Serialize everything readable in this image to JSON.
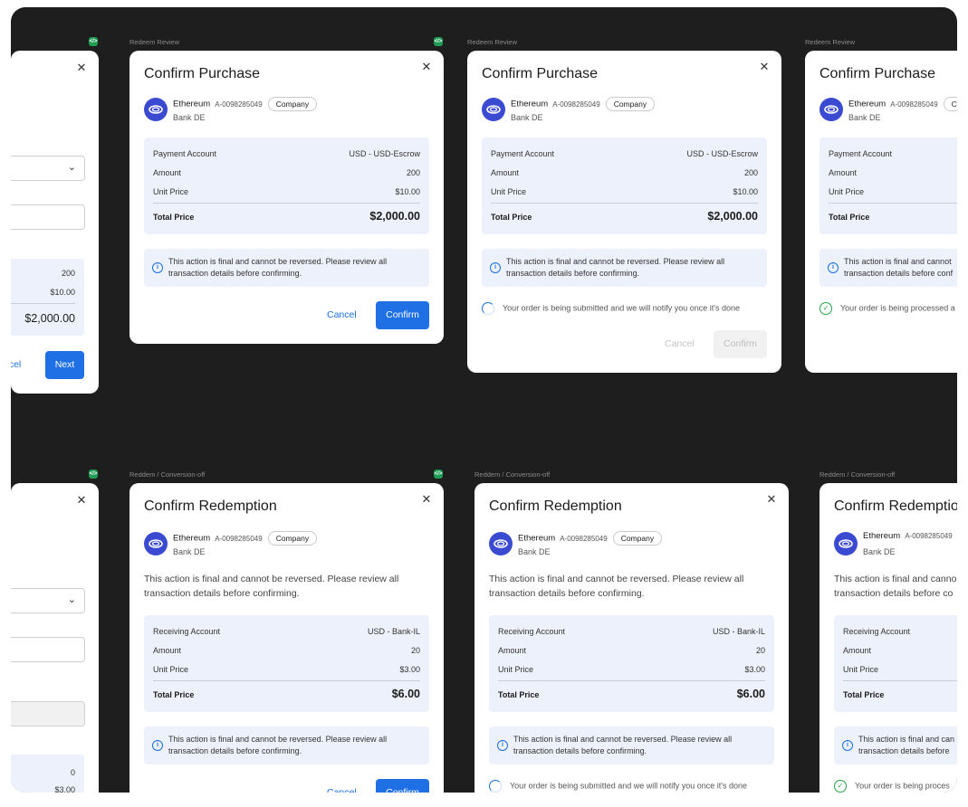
{
  "labels": {
    "top": "Redeem Review",
    "bottom": "Reddem / Conversion-off",
    "dev_badge": "</>"
  },
  "asset": {
    "name": "Ethereum",
    "id": "A-0098285049",
    "type_tag": "Company",
    "bank": "Bank DE"
  },
  "purchase": {
    "title": "Confirm Purchase",
    "rows": [
      {
        "label": "Payment Account",
        "value": "USD - USD-Escrow"
      },
      {
        "label": "Amount",
        "value": "200"
      },
      {
        "label": "Unit Price",
        "value": "$10.00"
      }
    ],
    "total_label": "Total Price",
    "total_value": "$2,000.00"
  },
  "redemption": {
    "title": "Confirm Redemption",
    "rows": [
      {
        "label": "Receiving Account",
        "value": "USD - Bank-IL"
      },
      {
        "label": "Amount",
        "value": "20"
      },
      {
        "label": "Unit Price",
        "value": "$3.00"
      }
    ],
    "total_label": "Total Price",
    "total_value": "$6.00",
    "warning_paragraph": "This action is final and cannot be reversed. Please review all transaction details before confirming."
  },
  "left_partial": {
    "top_values": [
      "200",
      "$10.00",
      "$2,000.00"
    ],
    "cancel_partial": "ncel",
    "next": "Next",
    "bottom_values": [
      "0",
      "$3.00"
    ]
  },
  "notice_text": "This action is final and cannot be reversed. Please review all transaction details before confirming.",
  "buttons": {
    "cancel": "Cancel",
    "confirm": "Confirm"
  },
  "status": {
    "submitting": "Your order is being submitted and we will notify you once it's done",
    "processed_partial": "Your order is being processed a",
    "processed_partial_bottom": "Your order is being proces"
  },
  "partial_right": {
    "tag_partial": "Co",
    "notice_partial_1": "This action is final and cannot",
    "notice_partial_2": "transaction details before conf",
    "bottom_para_1": "This action is final and canno",
    "bottom_para_2": "transaction details before co",
    "bottom_notice_1": "This action is final and can",
    "bottom_notice_2": "transaction details before"
  },
  "colors": {
    "canvas": "#1e1e1e",
    "primary": "#1f6fe5",
    "summary_bg": "#edf1fb",
    "success": "#25a244"
  }
}
